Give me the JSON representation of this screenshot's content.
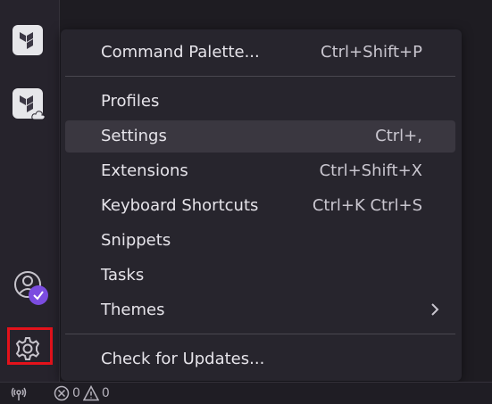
{
  "menu": {
    "items": [
      {
        "label": "Command Palette...",
        "shortcut": "Ctrl+Shift+P"
      },
      {
        "label": "Profiles",
        "shortcut": ""
      },
      {
        "label": "Settings",
        "shortcut": "Ctrl+,"
      },
      {
        "label": "Extensions",
        "shortcut": "Ctrl+Shift+X"
      },
      {
        "label": "Keyboard Shortcuts",
        "shortcut": "Ctrl+K Ctrl+S"
      },
      {
        "label": "Snippets",
        "shortcut": ""
      },
      {
        "label": "Tasks",
        "shortcut": ""
      },
      {
        "label": "Themes",
        "shortcut": ""
      },
      {
        "label": "Check for Updates...",
        "shortcut": ""
      }
    ],
    "active_item": "Settings",
    "submenu_icon": "chevron-right-icon"
  },
  "activity_bar": {
    "icons": [
      "terraform-icon",
      "terraform-cloud-icon",
      "account-icon",
      "settings-gear-icon"
    ],
    "account_badge_icon": "check-icon"
  },
  "status_bar": {
    "errors": "0",
    "warnings": "0",
    "remote_icon": "broadcast-icon"
  },
  "colors": {
    "menu_bg": "#27252d",
    "active_bg": "#3a3740",
    "badge": "#7b4ce0",
    "highlight": "#e3121b"
  }
}
